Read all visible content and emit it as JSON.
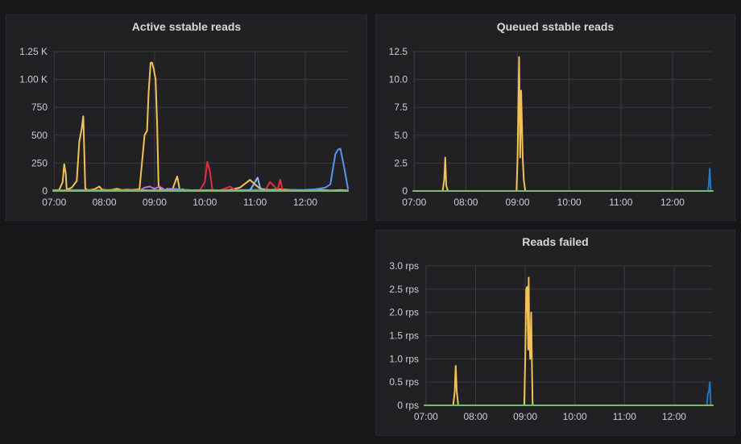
{
  "chart_data": [
    {
      "type": "line",
      "title": "Active sstable reads",
      "x_ticks": [
        "07:00",
        "08:00",
        "09:00",
        "10:00",
        "11:00",
        "12:00"
      ],
      "x_domain": [
        6.98,
        12.85
      ],
      "y_ticks": [
        "0",
        "250",
        "500",
        "750",
        "1.00 K",
        "1.25 K"
      ],
      "y_tick_values": [
        0,
        250,
        500,
        750,
        1000,
        1250
      ],
      "ylim": [
        0,
        1250
      ],
      "grid": true,
      "series": [
        {
          "color": "#f2c257",
          "x": [
            6.98,
            7.1,
            7.17,
            7.2,
            7.23,
            7.25,
            7.35,
            7.45,
            7.5,
            7.55,
            7.58,
            7.62,
            7.66,
            7.7,
            7.8,
            7.9,
            7.95,
            8.05,
            8.15,
            8.25,
            8.35,
            8.45,
            8.55,
            8.7,
            8.8,
            8.85,
            8.88,
            8.92,
            8.95,
            8.98,
            9.02,
            9.05,
            9.08,
            9.12,
            9.15,
            9.18,
            9.22,
            9.25,
            9.3,
            9.35,
            9.45,
            9.5,
            9.52,
            9.55,
            9.6,
            9.7,
            9.8,
            9.85,
            9.95,
            10.1,
            10.3,
            10.5,
            10.7,
            10.9,
            11.1,
            11.3,
            11.5,
            11.7,
            11.9,
            12.1,
            12.3,
            12.5,
            12.7,
            12.85
          ],
          "y": [
            5,
            10,
            80,
            240,
            160,
            10,
            30,
            90,
            440,
            560,
            670,
            20,
            10,
            8,
            15,
            40,
            12,
            8,
            10,
            20,
            8,
            12,
            10,
            15,
            500,
            540,
            880,
            1150,
            1150,
            1100,
            1000,
            600,
            40,
            15,
            10,
            8,
            10,
            20,
            10,
            8,
            130,
            10,
            8,
            15,
            10,
            8,
            5,
            8,
            6,
            8,
            5,
            10,
            30,
            100,
            20,
            10,
            15,
            10,
            8,
            5,
            10,
            5,
            8,
            5
          ]
        },
        {
          "color": "#5794f2",
          "x": [
            7.0,
            7.5,
            8.0,
            8.5,
            9.0,
            9.2,
            9.4,
            9.6,
            10.0,
            10.5,
            11.0,
            11.5,
            12.0,
            12.2,
            12.4,
            12.5,
            12.55,
            12.6,
            12.65,
            12.7,
            12.73,
            12.78,
            12.85
          ],
          "y": [
            5,
            8,
            5,
            8,
            5,
            10,
            20,
            8,
            5,
            8,
            10,
            8,
            10,
            15,
            30,
            60,
            200,
            330,
            370,
            380,
            310,
            200,
            20
          ]
        },
        {
          "color": "#e02f44",
          "x": [
            7.0,
            9.8,
            9.9,
            10.0,
            10.05,
            10.1,
            10.15,
            10.3,
            10.5,
            10.6,
            10.7,
            11.2,
            11.3,
            11.45,
            11.5,
            11.55,
            11.6,
            11.8,
            12.1,
            12.5,
            12.85
          ],
          "y": [
            3,
            3,
            5,
            80,
            260,
            180,
            10,
            5,
            40,
            10,
            5,
            5,
            80,
            10,
            100,
            10,
            5,
            5,
            5,
            3,
            3
          ]
        },
        {
          "color": "#8ab8ff",
          "x": [
            7.0,
            9.5,
            10.5,
            10.9,
            11.0,
            11.05,
            11.1,
            11.15,
            11.2,
            11.5,
            12.85
          ],
          "y": [
            3,
            5,
            5,
            5,
            80,
            120,
            30,
            10,
            5,
            5,
            3
          ]
        },
        {
          "color": "#b877d9",
          "x": [
            7.0,
            8.7,
            8.8,
            8.9,
            9.0,
            9.1,
            9.2,
            9.3,
            9.5,
            10.5,
            12.85
          ],
          "y": [
            3,
            3,
            30,
            40,
            20,
            40,
            10,
            20,
            5,
            3,
            3
          ]
        },
        {
          "color": "#73bf69",
          "x": [
            6.98,
            12.85
          ],
          "y": [
            0,
            0
          ]
        }
      ]
    },
    {
      "type": "line",
      "title": "Queued sstable reads",
      "x_ticks": [
        "07:00",
        "08:00",
        "09:00",
        "10:00",
        "11:00",
        "12:00"
      ],
      "x_domain": [
        6.98,
        12.78
      ],
      "y_ticks": [
        "0",
        "2.5",
        "5.0",
        "7.5",
        "10.0",
        "12.5"
      ],
      "y_tick_values": [
        0,
        2.5,
        5.0,
        7.5,
        10.0,
        12.5
      ],
      "ylim": [
        0,
        12.5
      ],
      "grid": true,
      "series": [
        {
          "color": "#f2c257",
          "x": [
            6.98,
            7.55,
            7.58,
            7.6,
            7.62,
            7.65,
            8.98,
            9.0,
            9.03,
            9.05,
            9.07,
            9.1,
            9.12,
            9.15,
            9.2,
            12.78
          ],
          "y": [
            0,
            0,
            1,
            3,
            0.5,
            0,
            0,
            3,
            12,
            3,
            9,
            3,
            1,
            0,
            0,
            0
          ]
        },
        {
          "color": "#1f78c1",
          "x": [
            6.98,
            12.68,
            12.7,
            12.72,
            12.74,
            12.78
          ],
          "y": [
            0,
            0,
            0.5,
            2,
            0,
            0
          ]
        },
        {
          "color": "#73bf69",
          "x": [
            6.98,
            12.78
          ],
          "y": [
            0,
            0
          ]
        }
      ]
    },
    {
      "type": "line",
      "title": "Reads failed",
      "x_ticks": [
        "07:00",
        "08:00",
        "09:00",
        "10:00",
        "11:00",
        "12:00"
      ],
      "x_domain": [
        6.97,
        12.78
      ],
      "y_ticks": [
        "0 rps",
        "0.5 rps",
        "1.0 rps",
        "1.5 rps",
        "2.0 rps",
        "2.5 rps",
        "3.0 rps"
      ],
      "y_tick_values": [
        0,
        0.5,
        1.0,
        1.5,
        2.0,
        2.5,
        3.0
      ],
      "ylim": [
        0,
        3.0
      ],
      "grid": true,
      "series": [
        {
          "color": "#f2c257",
          "x": [
            6.97,
            7.55,
            7.58,
            7.6,
            7.62,
            7.65,
            8.98,
            9.0,
            9.02,
            9.04,
            9.06,
            9.07,
            9.08,
            9.1,
            9.12,
            9.13,
            9.15,
            9.2,
            12.78
          ],
          "y": [
            0,
            0,
            0.3,
            0.85,
            0.3,
            0,
            0,
            1.0,
            2.5,
            2.55,
            1.2,
            2.75,
            1.6,
            1.0,
            2.0,
            1.2,
            0,
            0,
            0
          ]
        },
        {
          "color": "#1f78c1",
          "x": [
            6.97,
            12.66,
            12.68,
            12.7,
            12.72,
            12.74,
            12.78
          ],
          "y": [
            0,
            0,
            0.25,
            0.3,
            0.5,
            0,
            0
          ]
        },
        {
          "color": "#73bf69",
          "x": [
            6.97,
            12.78
          ],
          "y": [
            0,
            0
          ]
        }
      ]
    }
  ]
}
